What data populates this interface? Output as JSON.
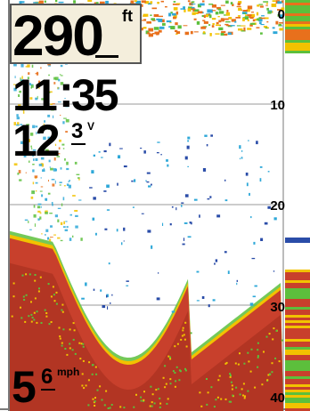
{
  "readouts": {
    "depth_value": "290",
    "depth_unit": "ft",
    "time_hours": "11",
    "time_separator": ":",
    "time_minutes": "35",
    "voltage_main": "12",
    "voltage_decimal": "3",
    "voltage_unit": "V",
    "speed_main": "5",
    "speed_decimal": "6",
    "speed_unit": "mph"
  },
  "depth_scale": {
    "labels": [
      "0",
      "10",
      "20",
      "30",
      "40"
    ],
    "max": 40
  },
  "colors": {
    "bottom": "#c8402c",
    "bottom_dark": "#a83020",
    "return_yellow": "#f2c200",
    "return_green": "#5cbf3c",
    "return_cyan": "#2ea8d8",
    "return_blue": "#2a4ca8",
    "surface_orange": "#e8701c"
  }
}
